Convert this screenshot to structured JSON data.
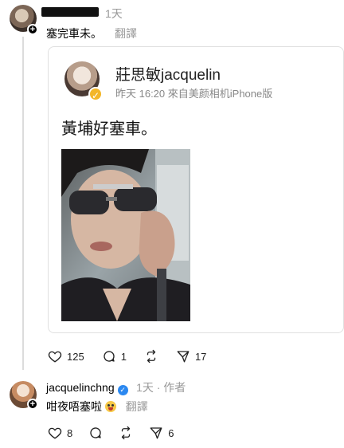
{
  "comment1": {
    "time": "1天",
    "text": "塞完車未。",
    "translate": "翻譯"
  },
  "quoted_post": {
    "author": "莊思敏jacquelin",
    "meta": "昨天 16:20  來自美颜相机iPhone版",
    "text": "黃埔好塞車。"
  },
  "actions1": {
    "likes": "125",
    "comments": "1",
    "shares": "17"
  },
  "reply": {
    "username": "jacquelinchng",
    "time": "1天 · 作者",
    "text": "咁夜唔塞啦",
    "translate": "翻譯"
  },
  "actions2": {
    "likes": "8",
    "shares": "6"
  }
}
